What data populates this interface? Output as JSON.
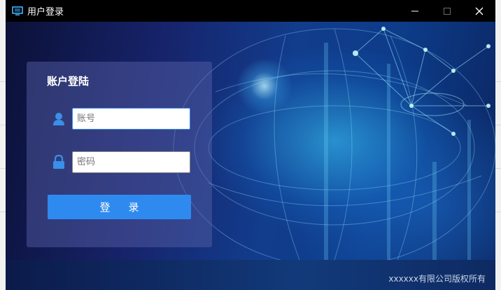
{
  "window": {
    "title": "用户登录",
    "controls": {
      "minimize": "minimize-icon",
      "maximize": "maximize-icon",
      "close": "close-icon"
    }
  },
  "login": {
    "heading": "账户登陆",
    "account_placeholder": "账号",
    "account_value": "",
    "password_placeholder": "密码",
    "password_value": "",
    "submit_label": "登录",
    "icons": {
      "account": "user-icon",
      "password": "lock-icon"
    }
  },
  "footer": {
    "copyright": "xxxxxx有限公司版权所有"
  },
  "colors": {
    "titlebar": "#000000",
    "accent": "#2f8af0",
    "panel": "#5a64aa",
    "background": "#0b1138"
  }
}
